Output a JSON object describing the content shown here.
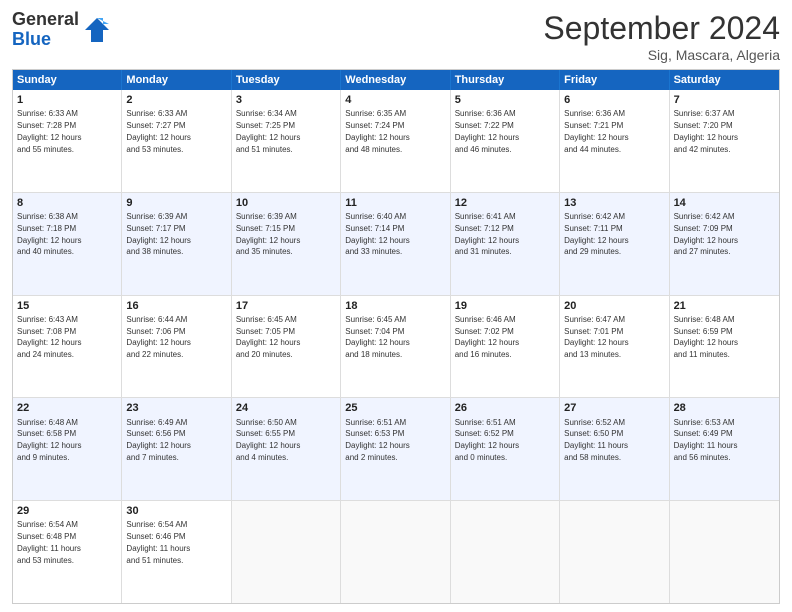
{
  "header": {
    "logo_general": "General",
    "logo_blue": "Blue",
    "month_title": "September 2024",
    "location": "Sig, Mascara, Algeria"
  },
  "days": [
    "Sunday",
    "Monday",
    "Tuesday",
    "Wednesday",
    "Thursday",
    "Friday",
    "Saturday"
  ],
  "rows": [
    [
      {
        "day": "",
        "text": ""
      },
      {
        "day": "2",
        "text": "Sunrise: 6:33 AM\nSunset: 7:27 PM\nDaylight: 12 hours\nand 53 minutes."
      },
      {
        "day": "3",
        "text": "Sunrise: 6:34 AM\nSunset: 7:25 PM\nDaylight: 12 hours\nand 51 minutes."
      },
      {
        "day": "4",
        "text": "Sunrise: 6:35 AM\nSunset: 7:24 PM\nDaylight: 12 hours\nand 48 minutes."
      },
      {
        "day": "5",
        "text": "Sunrise: 6:36 AM\nSunset: 7:22 PM\nDaylight: 12 hours\nand 46 minutes."
      },
      {
        "day": "6",
        "text": "Sunrise: 6:36 AM\nSunset: 7:21 PM\nDaylight: 12 hours\nand 44 minutes."
      },
      {
        "day": "7",
        "text": "Sunrise: 6:37 AM\nSunset: 7:20 PM\nDaylight: 12 hours\nand 42 minutes."
      }
    ],
    [
      {
        "day": "8",
        "text": "Sunrise: 6:38 AM\nSunset: 7:18 PM\nDaylight: 12 hours\nand 40 minutes."
      },
      {
        "day": "9",
        "text": "Sunrise: 6:39 AM\nSunset: 7:17 PM\nDaylight: 12 hours\nand 38 minutes."
      },
      {
        "day": "10",
        "text": "Sunrise: 6:39 AM\nSunset: 7:15 PM\nDaylight: 12 hours\nand 35 minutes."
      },
      {
        "day": "11",
        "text": "Sunrise: 6:40 AM\nSunset: 7:14 PM\nDaylight: 12 hours\nand 33 minutes."
      },
      {
        "day": "12",
        "text": "Sunrise: 6:41 AM\nSunset: 7:12 PM\nDaylight: 12 hours\nand 31 minutes."
      },
      {
        "day": "13",
        "text": "Sunrise: 6:42 AM\nSunset: 7:11 PM\nDaylight: 12 hours\nand 29 minutes."
      },
      {
        "day": "14",
        "text": "Sunrise: 6:42 AM\nSunset: 7:09 PM\nDaylight: 12 hours\nand 27 minutes."
      }
    ],
    [
      {
        "day": "15",
        "text": "Sunrise: 6:43 AM\nSunset: 7:08 PM\nDaylight: 12 hours\nand 24 minutes."
      },
      {
        "day": "16",
        "text": "Sunrise: 6:44 AM\nSunset: 7:06 PM\nDaylight: 12 hours\nand 22 minutes."
      },
      {
        "day": "17",
        "text": "Sunrise: 6:45 AM\nSunset: 7:05 PM\nDaylight: 12 hours\nand 20 minutes."
      },
      {
        "day": "18",
        "text": "Sunrise: 6:45 AM\nSunset: 7:04 PM\nDaylight: 12 hours\nand 18 minutes."
      },
      {
        "day": "19",
        "text": "Sunrise: 6:46 AM\nSunset: 7:02 PM\nDaylight: 12 hours\nand 16 minutes."
      },
      {
        "day": "20",
        "text": "Sunrise: 6:47 AM\nSunset: 7:01 PM\nDaylight: 12 hours\nand 13 minutes."
      },
      {
        "day": "21",
        "text": "Sunrise: 6:48 AM\nSunset: 6:59 PM\nDaylight: 12 hours\nand 11 minutes."
      }
    ],
    [
      {
        "day": "22",
        "text": "Sunrise: 6:48 AM\nSunset: 6:58 PM\nDaylight: 12 hours\nand 9 minutes."
      },
      {
        "day": "23",
        "text": "Sunrise: 6:49 AM\nSunset: 6:56 PM\nDaylight: 12 hours\nand 7 minutes."
      },
      {
        "day": "24",
        "text": "Sunrise: 6:50 AM\nSunset: 6:55 PM\nDaylight: 12 hours\nand 4 minutes."
      },
      {
        "day": "25",
        "text": "Sunrise: 6:51 AM\nSunset: 6:53 PM\nDaylight: 12 hours\nand 2 minutes."
      },
      {
        "day": "26",
        "text": "Sunrise: 6:51 AM\nSunset: 6:52 PM\nDaylight: 12 hours\nand 0 minutes."
      },
      {
        "day": "27",
        "text": "Sunrise: 6:52 AM\nSunset: 6:50 PM\nDaylight: 11 hours\nand 58 minutes."
      },
      {
        "day": "28",
        "text": "Sunrise: 6:53 AM\nSunset: 6:49 PM\nDaylight: 11 hours\nand 56 minutes."
      }
    ],
    [
      {
        "day": "29",
        "text": "Sunrise: 6:54 AM\nSunset: 6:48 PM\nDaylight: 11 hours\nand 53 minutes."
      },
      {
        "day": "30",
        "text": "Sunrise: 6:54 AM\nSunset: 6:46 PM\nDaylight: 11 hours\nand 51 minutes."
      },
      {
        "day": "",
        "text": ""
      },
      {
        "day": "",
        "text": ""
      },
      {
        "day": "",
        "text": ""
      },
      {
        "day": "",
        "text": ""
      },
      {
        "day": "",
        "text": ""
      }
    ]
  ],
  "row0_day1": {
    "day": "1",
    "text": "Sunrise: 6:33 AM\nSunset: 7:28 PM\nDaylight: 12 hours\nand 55 minutes."
  }
}
